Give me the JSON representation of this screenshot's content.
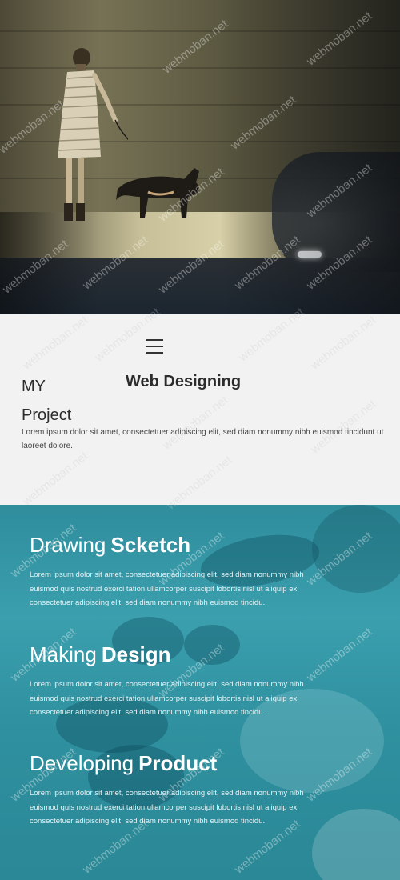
{
  "hero": {
    "watermark": "webmoban.net"
  },
  "intro": {
    "title_part1": "MY",
    "title_part2": "Project",
    "heading": "Web Designing",
    "text": "Lorem ipsum dolor sit amet, consectetuer adipiscing elit, sed diam nonummy nibh euismod tincidunt ut laoreet dolore."
  },
  "process": {
    "steps": [
      {
        "light": "Drawing",
        "bold": "Scketch",
        "text": "Lorem ipsum dolor sit amet, consectetuer adipiscing elit, sed diam nonummy nibh euismod quis nostrud exerci tation ullamcorper suscipit lobortis nisl ut aliquip ex consectetuer adipiscing elit, sed diam nonummy nibh euismod tincidu."
      },
      {
        "light": "Making",
        "bold": "Design",
        "text": "Lorem ipsum dolor sit amet, consectetuer adipiscing elit, sed diam nonummy nibh euismod quis nostrud exerci tation ullamcorper suscipit lobortis nisl ut aliquip ex consectetuer adipiscing elit, sed diam nonummy nibh euismod tincidu."
      },
      {
        "light": "Developing",
        "bold": "Product",
        "text": "Lorem ipsum dolor sit amet, consectetuer adipiscing elit, sed diam nonummy nibh euismod quis nostrud exerci tation ullamcorper suscipit lobortis nisl ut aliquip ex consectetuer adipiscing elit, sed diam nonummy nibh euismod tincidu."
      }
    ]
  },
  "colors": {
    "teal": "#3b9fae",
    "text_dark": "#2c2c2c",
    "intro_bg": "#f2f2f2"
  },
  "icons": {
    "menu": "hamburger-menu-icon"
  }
}
